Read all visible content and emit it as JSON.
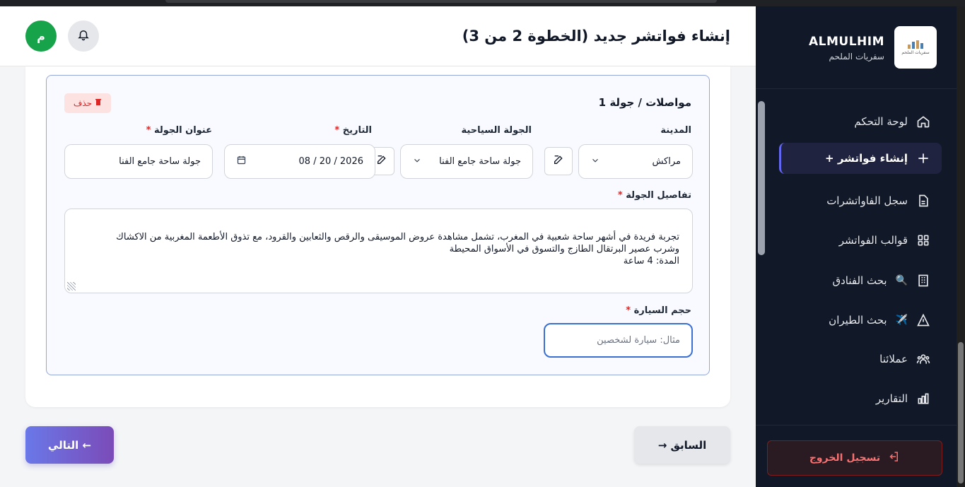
{
  "brand": {
    "title": "ALMULHIM",
    "subtitle": "سفريات الملحم",
    "logo_text": "سفريات الملحم"
  },
  "header": {
    "title": "إنشاء فواتشر جديد (الخطوة 2 من 3)",
    "avatar_letter": "م"
  },
  "sidebar": {
    "items": [
      {
        "label": "لوحة التحكم",
        "icon": "home-icon"
      },
      {
        "label": "+ إنشاء فواتشر",
        "icon": "plus-icon",
        "active": true
      },
      {
        "label": "سجل الفاواتشرات",
        "icon": "document-icon"
      },
      {
        "label": "قوالب الفواتشر",
        "icon": "grid-icon"
      },
      {
        "label": "بحث الفنادق",
        "icon": "building-icon",
        "emoji": "🔍"
      },
      {
        "label": "بحث الطيران",
        "icon": "navigation-icon",
        "emoji": "✈️"
      },
      {
        "label": "عملائنا",
        "icon": "users-icon"
      },
      {
        "label": "التقارير",
        "icon": "chart-icon"
      }
    ],
    "logout_label": "تسجيل الخروج"
  },
  "tour": {
    "title": "مواصلات / جولة 1",
    "delete_label": "حذف",
    "city_label": "المدينة",
    "city_value": "مراكش",
    "tour_label": "الجولة السياحية",
    "tour_value": "جولة ساحة جامع الفنا",
    "date_label": "التاريخ",
    "date_value": "08 / 20 / 2026",
    "title_label": "عنوان الجولة",
    "title_value": "جولة ساحة جامع الفنا",
    "details_label": "تفاصيل الجولة",
    "details_value": "تجربة فريدة في أشهر ساحة شعبية في المغرب، تشمل مشاهدة عروض الموسيقى والرقص والثعابين والقرود، مع تذوق الأطعمة المغربية من الاكشاك\nوشرب عصير البرتقال الطازج والتسوق في الأسواق المحيطة\nالمدة: 4 ساعة",
    "car_label": "حجم السيارة",
    "car_placeholder": "مثال: سيارة لشخصين",
    "required_mark": "*"
  },
  "actions": {
    "next_label": "التالي ←",
    "prev_label": "→ السابق"
  },
  "colors": {
    "sidebar_bg": "#111827",
    "accent": "#6366f1",
    "avatar": "#16a34a",
    "danger": "#dc2626"
  }
}
